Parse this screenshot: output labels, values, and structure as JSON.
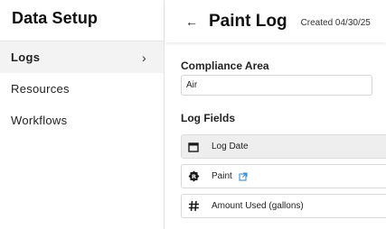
{
  "sidebar": {
    "title": "Data Setup",
    "items": [
      {
        "label": "Logs",
        "active": true
      },
      {
        "label": "Resources",
        "active": false
      },
      {
        "label": "Workflows",
        "active": false
      }
    ],
    "chevron_icon": "chevron-right-icon"
  },
  "header": {
    "title": "Paint Log",
    "created": "Created 04/30/25",
    "back_icon": "arrow-left-icon"
  },
  "form": {
    "compliance_label": "Compliance Area",
    "compliance_value": "Air",
    "fields_label": "Log Fields",
    "fields": [
      {
        "label": "Log Date",
        "icon": "calendar-icon",
        "selected": true
      },
      {
        "label": "Paint",
        "icon": "resource-icon",
        "link_icon": "external-link-icon"
      },
      {
        "label": "Amount Used (gallons)",
        "icon": "hash-icon"
      }
    ]
  },
  "colors": {
    "link": "#3b8fd9",
    "selected_row": "#eeeeee",
    "active_nav": "#f3f3f3"
  }
}
